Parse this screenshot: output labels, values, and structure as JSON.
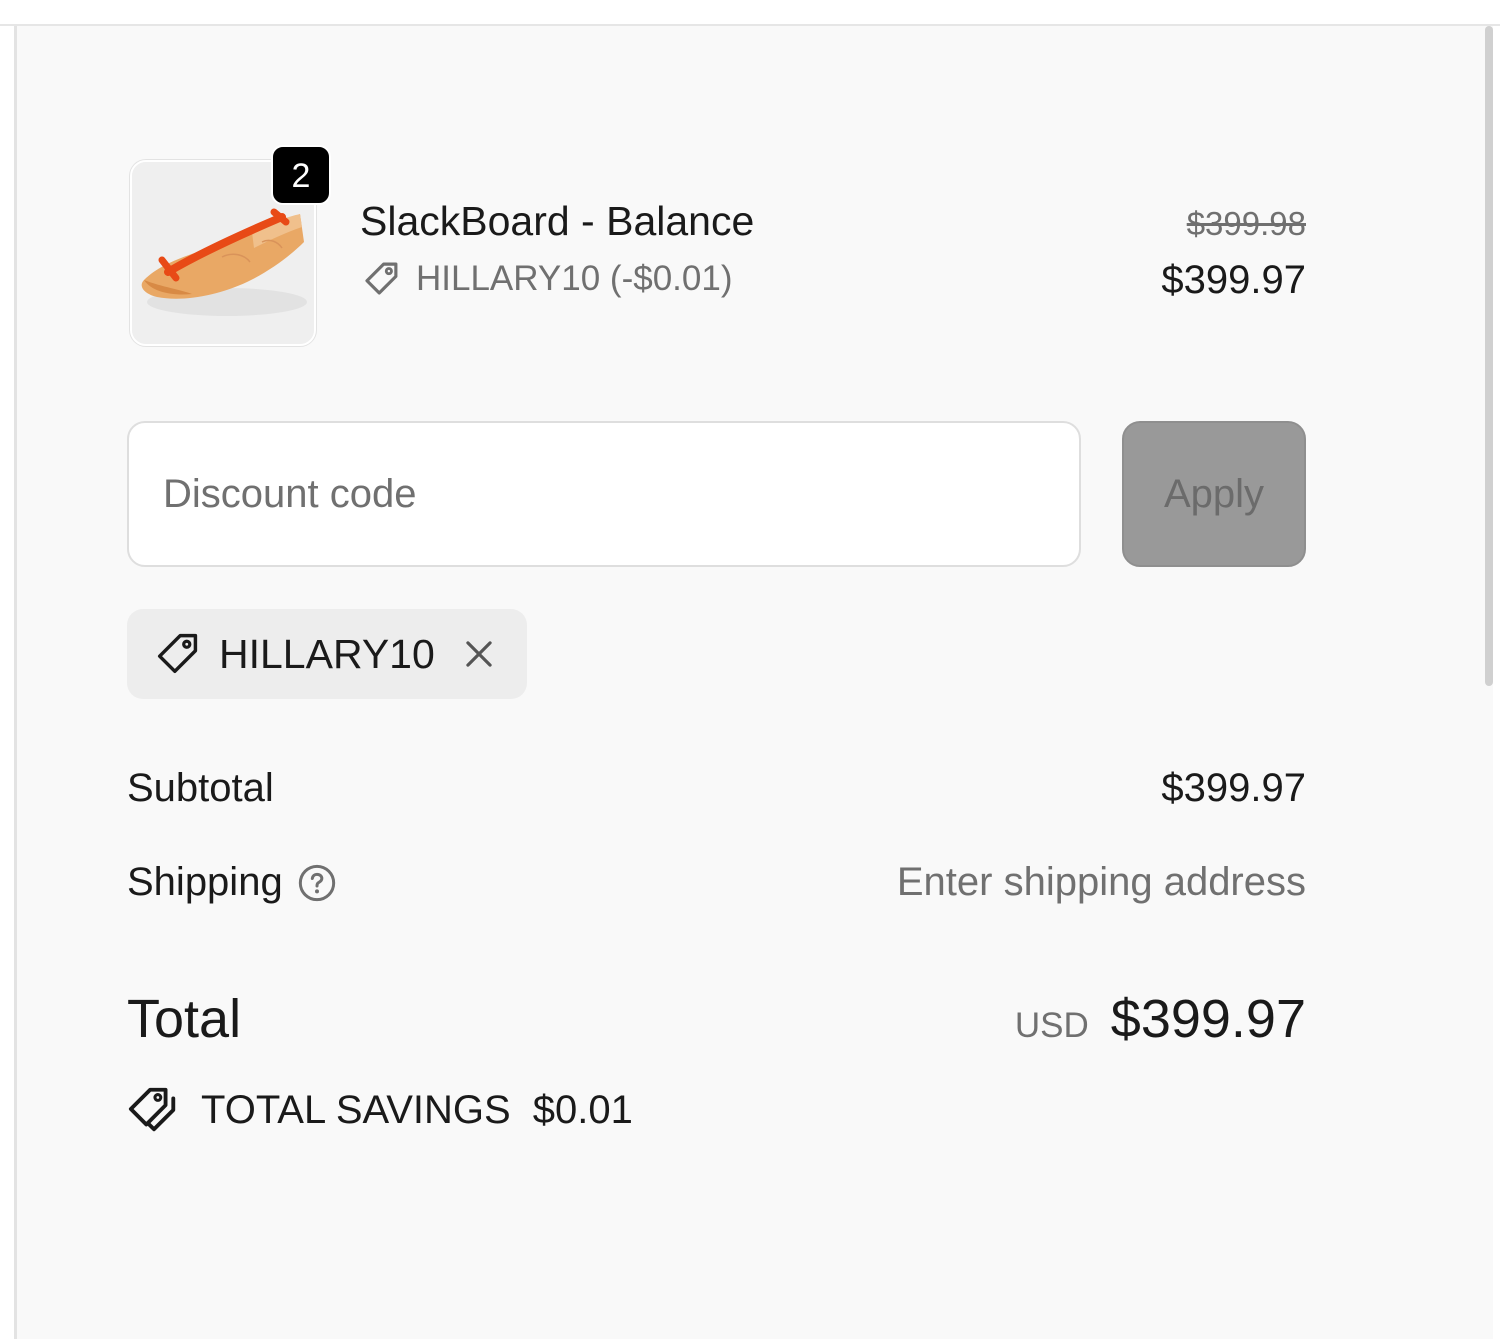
{
  "product": {
    "name": "SlackBoard - Balance",
    "quantity": "2",
    "discount_line": "HILLARY10 (-$0.01)",
    "original_price": "$399.98",
    "final_price": "$399.97",
    "image_icon": "product-thumbnail-image"
  },
  "discount": {
    "placeholder": "Discount code",
    "value": "",
    "apply_label": "Apply",
    "applied_code": "HILLARY10"
  },
  "summary": {
    "subtotal_label": "Subtotal",
    "subtotal_value": "$399.97",
    "shipping_label": "Shipping",
    "shipping_value": "Enter shipping address",
    "total_label": "Total",
    "total_currency": "USD",
    "total_value": "$399.97",
    "savings_label": "TOTAL SAVINGS",
    "savings_value": "$0.01"
  },
  "icons": {
    "tag": "tag-icon",
    "remove": "close-icon",
    "help": "question-circle-icon",
    "savings": "tags-icon"
  },
  "colors": {
    "panel_bg": "#f9f9f9",
    "badge_bg": "#000000",
    "apply_disabled_bg": "#999999",
    "muted_text": "#707070"
  }
}
